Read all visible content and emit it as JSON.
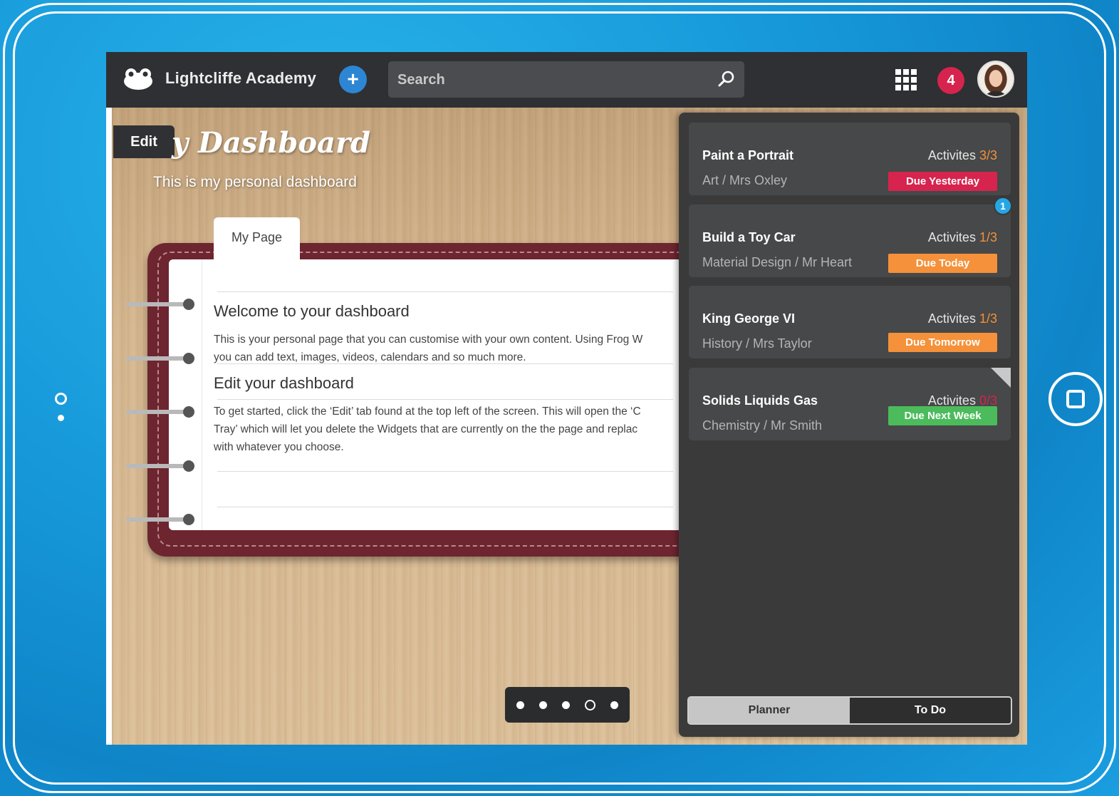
{
  "header": {
    "school_name": "Lightcliffe Academy",
    "add_label": "+",
    "search_placeholder": "Search",
    "notification_count": "4"
  },
  "dashboard": {
    "edit_label": "Edit",
    "title": "y Dashboard",
    "subtitle": "This is my personal dashboard",
    "page_tab": "My Page",
    "welcome_heading": "Welcome to your dashboard",
    "welcome_lines": [
      "This is your personal page that you can customise with your own content. Using Frog W",
      "you can add text, images, videos, calendars and so much more."
    ],
    "edit_heading": "Edit your dashboard",
    "edit_lines": [
      "To get started, click the ‘Edit’ tab found at the top left of the screen. This will open the ‘C",
      "Tray’ which will let you delete the Widgets that are currently on the the page and replac",
      "with whatever you choose."
    ]
  },
  "pager": {
    "total": 5,
    "current_index": 3
  },
  "planner": {
    "activities_label": "Activites",
    "cards": [
      {
        "title": "Paint a Portrait",
        "meta": "Art / Mrs Oxley",
        "count": "3/3",
        "due": "Due Yesterday",
        "due_color": "#d6244e"
      },
      {
        "title": "Build a Toy Car",
        "meta": "Material Design / Mr Heart",
        "count": "1/3",
        "due": "Due Today",
        "due_color": "#f4913a",
        "badge": "1"
      },
      {
        "title": "King George VI",
        "meta": "History / Mrs Taylor",
        "count": "1/3",
        "due": "Due Tomorrow",
        "due_color": "#f4913a"
      },
      {
        "title": "Solids Liquids Gas",
        "meta": "Chemistry / Mr Smith",
        "count": "0/3",
        "due": "Due Next Week",
        "due_color": "#4cbb5b"
      }
    ],
    "tabs": {
      "planner": "Planner",
      "todo": "To Do"
    }
  },
  "colors": {
    "accent": "#2d86d3",
    "topbar": "#2e3033",
    "panel": "#3a3a3b",
    "binder": "#6d2530"
  },
  "icons": [
    "frog-logo-icon",
    "plus-icon",
    "search-icon",
    "apps-grid-icon",
    "avatar"
  ]
}
